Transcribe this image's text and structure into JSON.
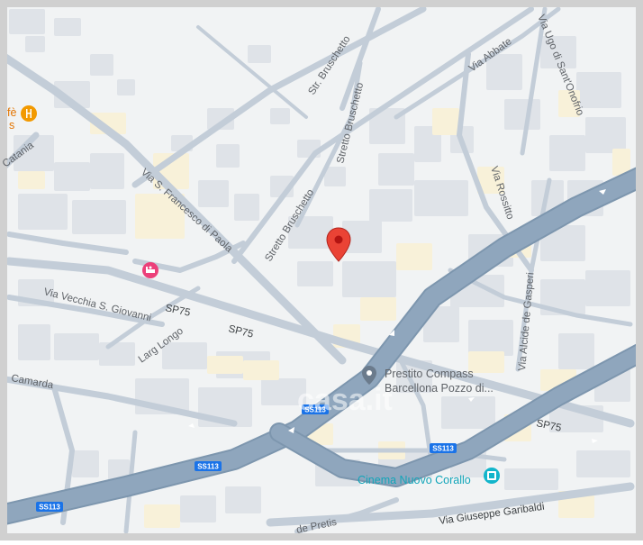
{
  "map": {
    "colors": {
      "background": "#f1f3f4",
      "block": "#dfe3e8",
      "yellow_block": "#f8f1d9",
      "road_minor": "#c3cdd8",
      "road_major": "#8fa6bd",
      "road_major_edge": "#7d96ae",
      "pin": "#ea4335",
      "cinema_poi": "#12b5cb",
      "hotel_poi": "#ec407a",
      "food_poi": "#f29900",
      "label": "#5f6368",
      "shield": "#1a73e8",
      "frame": "#d0d0d0"
    },
    "streets": [
      {
        "id": "str-bruschetto",
        "label": "Str. Bruschetto"
      },
      {
        "id": "stretto-bruschetto-upper",
        "label": "Stretto Bruschetto"
      },
      {
        "id": "stretto-bruschetto-lower",
        "label": "Stretto Bruschetto"
      },
      {
        "id": "via-abbate",
        "label": "Via Abbate"
      },
      {
        "id": "via-ugo",
        "label": "Via Ugo di Sant'Onofrio"
      },
      {
        "id": "via-rossitto",
        "label": "Via Rossitto"
      },
      {
        "id": "via-san-francesco",
        "label": "Via S. Francesco di Paola"
      },
      {
        "id": "via-catania",
        "label": "Catania"
      },
      {
        "id": "via-vecchia",
        "label": "Via Vecchia S. Giovanni"
      },
      {
        "id": "largo-longo",
        "label": "Larg Longo"
      },
      {
        "id": "sp75-a",
        "label": "SP75"
      },
      {
        "id": "sp75-b",
        "label": "SP75"
      },
      {
        "id": "sp75-c",
        "label": "SP75"
      },
      {
        "id": "camarda",
        "label": "Camarda"
      },
      {
        "id": "via-alcide",
        "label": "Via Alcide de Gasperi"
      },
      {
        "id": "via-garibaldi",
        "label": "Via Giuseppe Garibaldi"
      },
      {
        "id": "de-pretis",
        "label": "de Pretis"
      }
    ],
    "shields": [
      {
        "id": "ss113-a",
        "label": "SS113"
      },
      {
        "id": "ss113-b",
        "label": "SS113"
      },
      {
        "id": "ss113-c",
        "label": "SS113"
      },
      {
        "id": "ss113-d",
        "label": "SS113"
      }
    ],
    "pois": {
      "prestito_line1": "Prestito Compass",
      "prestito_line2": "Barcellona Pozzo di...",
      "cinema": "Cinema Nuovo Corallo",
      "cafe_partial": "fè",
      "cafe_partial2": "s"
    },
    "watermark": "casa.it",
    "marker": {
      "icon": "location-pin-icon",
      "color": "#ea4335"
    }
  }
}
